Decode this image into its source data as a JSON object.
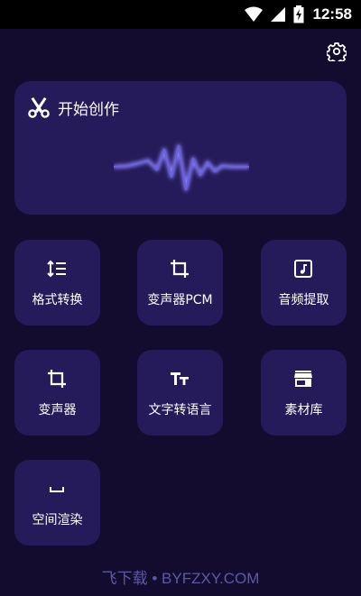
{
  "status_bar": {
    "time": "12:58",
    "icons": [
      "wifi-icon",
      "signal-icon",
      "battery-charging-icon"
    ]
  },
  "header": {
    "settings_icon": "gear-icon"
  },
  "hero": {
    "title": "开始创作",
    "icon": "scissors-icon",
    "graphic": "audio-waveform"
  },
  "tiles": [
    {
      "label": "格式转换",
      "icon": "format-list-icon"
    },
    {
      "label": "变声器PCM",
      "icon": "crop-icon"
    },
    {
      "label": "音频提取",
      "icon": "music-note-icon"
    },
    {
      "label": "变声器",
      "icon": "crop-icon"
    },
    {
      "label": "文字转语言",
      "icon": "text-size-icon"
    },
    {
      "label": "素材库",
      "icon": "store-icon"
    },
    {
      "label": "空间渲染",
      "icon": "space-bar-icon"
    }
  ],
  "footer": {
    "watermark": "飞下载 • BYFZXY.COM"
  },
  "colors": {
    "background": "#140c2f",
    "card": "#261b5a",
    "accent": "#5b4fd9",
    "watermark": "#5c5aa3"
  }
}
